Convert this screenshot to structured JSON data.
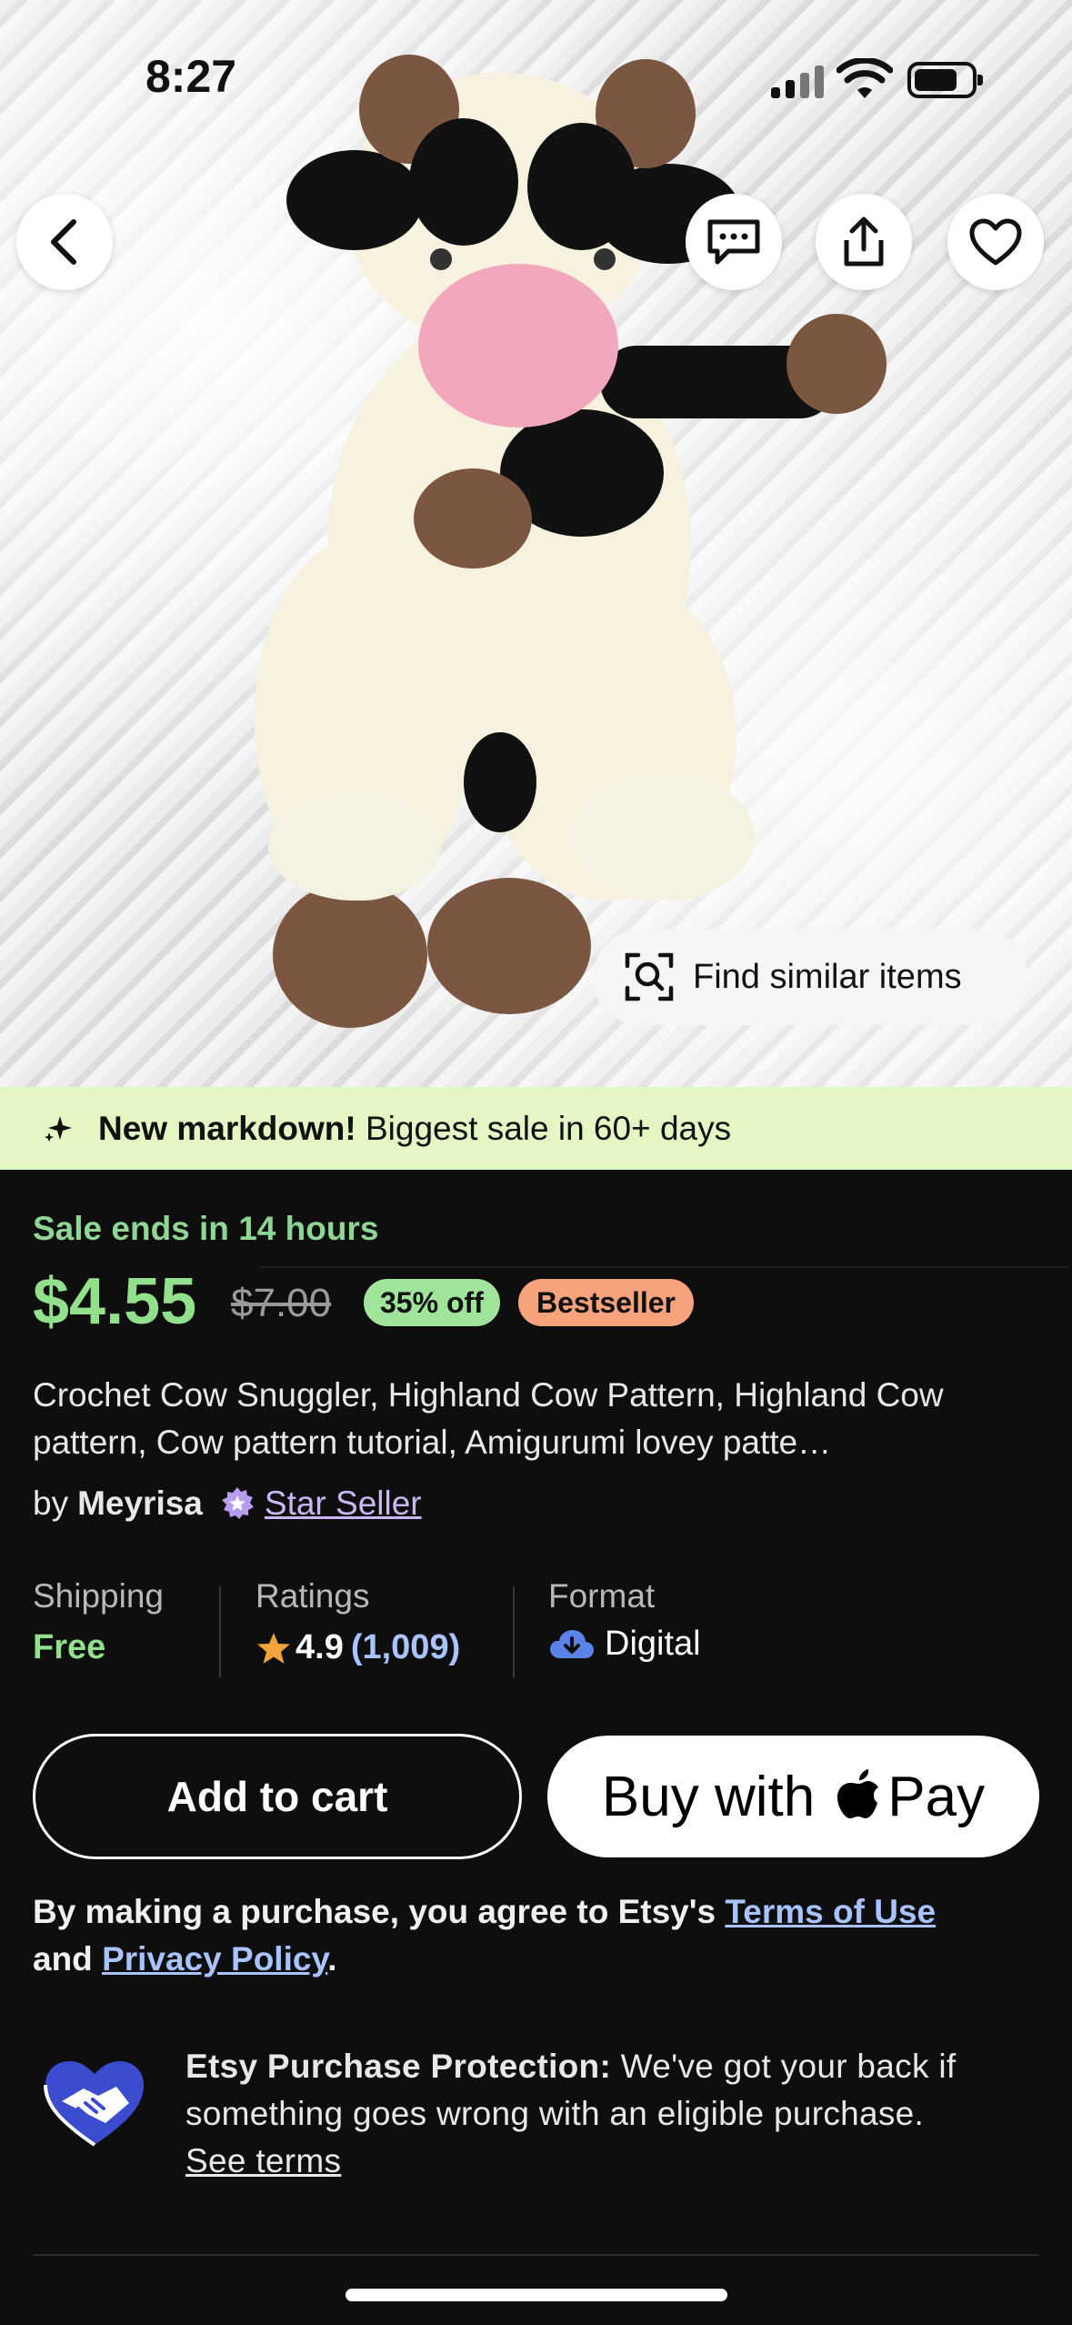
{
  "status": {
    "time": "8:27"
  },
  "photo": {
    "alt": "Crochet cow snuggler on white fur",
    "find_similar_label": "Find similar items"
  },
  "banner": {
    "bold": "New markdown!",
    "text": " Biggest sale in 60+ days"
  },
  "listing": {
    "sale_text": "Sale ends in 14 hours",
    "price": "$4.55",
    "original_price": "$7.00",
    "discount_badge": "35% off",
    "bestseller_badge": "Bestseller",
    "title": "Crochet Cow Snuggler, Highland Cow Pattern, Highland Cow pattern, Cow pattern tutorial, Amigurumi lovey patte…",
    "by": "by",
    "shop": "Meyrisa",
    "star_seller": "Star Seller"
  },
  "info": {
    "shipping_label": "Shipping",
    "shipping_value": "Free",
    "ratings_label": "Ratings",
    "rating": "4.9",
    "rating_count": "(1,009)",
    "format_label": "Format",
    "format_value": "Digital"
  },
  "buttons": {
    "add_to_cart": "Add to cart",
    "buy_with": "Buy with",
    "pay": "Pay"
  },
  "legal": {
    "prefix": "By making a purchase, you agree to Etsy's ",
    "terms": "Terms of Use",
    "and": "and ",
    "privacy": "Privacy Policy",
    "period": "."
  },
  "protection": {
    "bold": "Etsy Purchase Protection:",
    "text": " We've got your back if something goes wrong with an eligible purchase.",
    "link": "See terms"
  },
  "colors": {
    "sale_green": "#93e08c",
    "banner_bg": "#e3f6c3",
    "bestseller": "#f6a27d",
    "star_seller": "#c9b6f2",
    "link": "#a9c3ff"
  }
}
